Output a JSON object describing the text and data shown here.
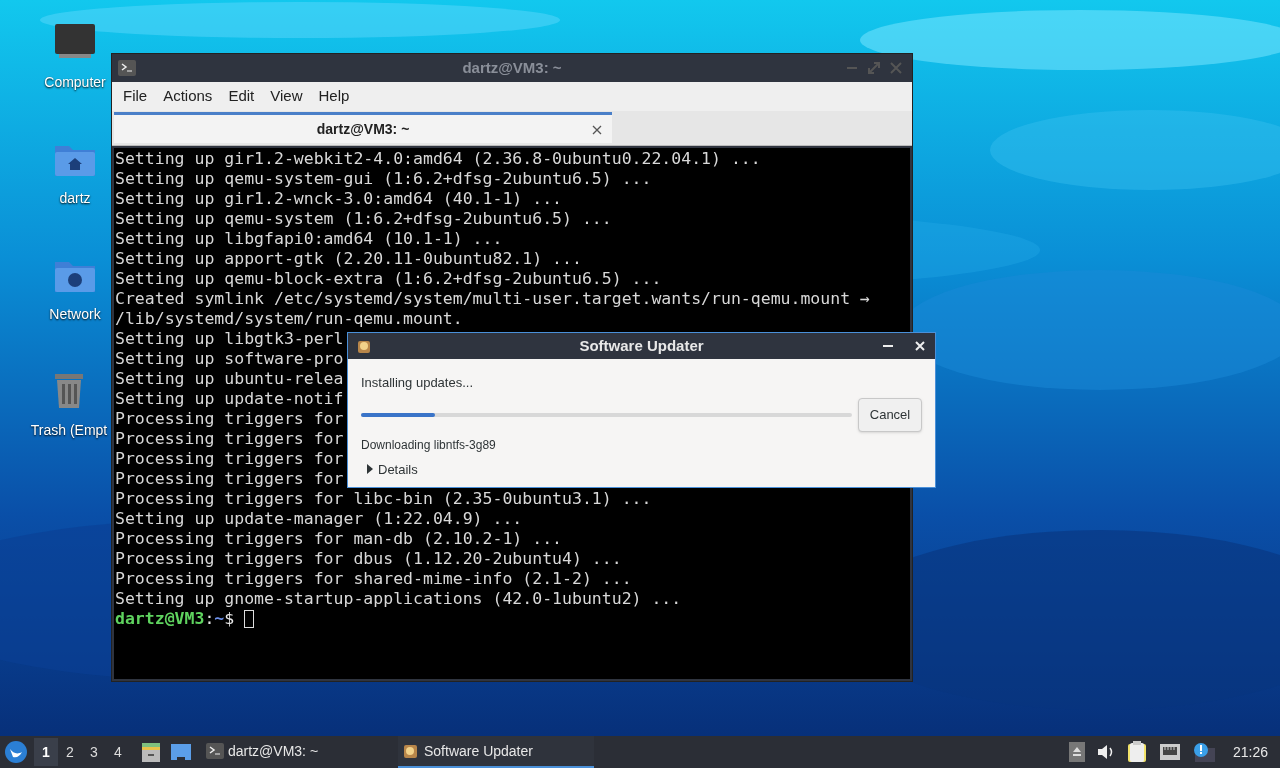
{
  "desktop_icons": [
    {
      "kind": "computer",
      "label": "Computer"
    },
    {
      "kind": "home",
      "label": "dartz"
    },
    {
      "kind": "network",
      "label": "Network"
    },
    {
      "kind": "trash",
      "label": "Trash (Empt"
    }
  ],
  "terminal": {
    "window_title": "dartz@VM3: ~",
    "menu": [
      "File",
      "Actions",
      "Edit",
      "View",
      "Help"
    ],
    "tabs": [
      {
        "label": "dartz@VM3: ~",
        "selected": true
      }
    ],
    "lines": [
      "Setting up gir1.2-webkit2-4.0:amd64 (2.36.8-0ubuntu0.22.04.1) ...",
      "Setting up qemu-system-gui (1:6.2+dfsg-2ubuntu6.5) ...",
      "Setting up gir1.2-wnck-3.0:amd64 (40.1-1) ...",
      "Setting up qemu-system (1:6.2+dfsg-2ubuntu6.5) ...",
      "Setting up libgfapi0:amd64 (10.1-1) ...",
      "Setting up apport-gtk (2.20.11-0ubuntu82.1) ...",
      "Setting up qemu-block-extra (1:6.2+dfsg-2ubuntu6.5) ...",
      "Created symlink /etc/systemd/system/multi-user.target.wants/run-qemu.mount →",
      "/lib/systemd/system/run-qemu.mount.",
      "Setting up libgtk3-perl",
      "Setting up software-pro",
      "Setting up ubuntu-relea",
      "Setting up update-notif",
      "Processing triggers for",
      "Processing triggers for",
      "Processing triggers for",
      "Processing triggers for",
      "Processing triggers for libc-bin (2.35-0ubuntu3.1) ...",
      "Setting up update-manager (1:22.04.9) ...",
      "Processing triggers for man-db (2.10.2-1) ...",
      "Processing triggers for dbus (1.12.20-2ubuntu4) ...",
      "Processing triggers for shared-mime-info (2.1-2) ...",
      "Setting up gnome-startup-applications (42.0-1ubuntu2) ..."
    ],
    "prompt": {
      "user": "dartz@VM3",
      "separator": ":",
      "path": "~",
      "symbol": "$"
    }
  },
  "dialog": {
    "title": "Software Updater",
    "status": "Installing updates...",
    "progress": {
      "level": 0.15
    },
    "cancel": "Cancel",
    "detail": "Downloading libntfs-3g89",
    "expander": {
      "label": "Details",
      "expanded": false
    }
  },
  "taskbar": {
    "workspaces": [
      {
        "label": "1",
        "selected": true
      },
      {
        "label": "2",
        "selected": false
      },
      {
        "label": "3",
        "selected": false
      },
      {
        "label": "4",
        "selected": false
      }
    ],
    "tasks": [
      {
        "kind": "terminal",
        "label": "dartz@VM3: ~",
        "selected": false
      },
      {
        "kind": "updater",
        "label": "Software Updater",
        "selected": true
      }
    ],
    "clock": "21:26"
  }
}
